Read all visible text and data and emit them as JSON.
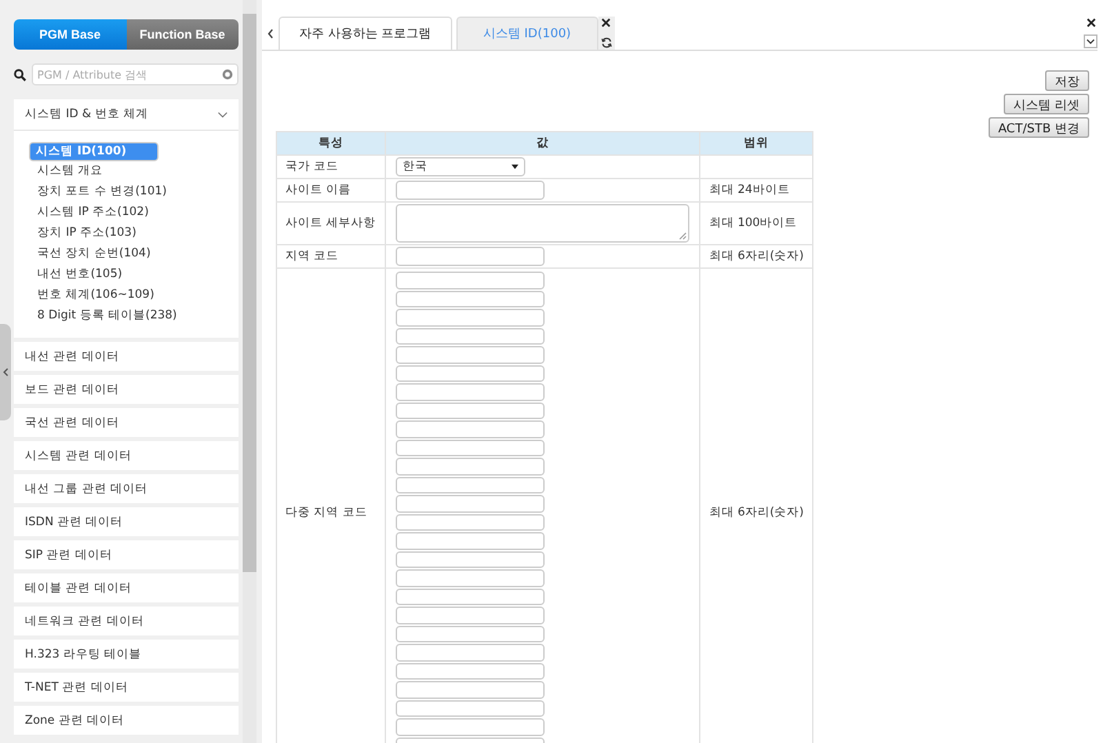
{
  "sidebar": {
    "mode_toggle": [
      {
        "label": "PGM Base",
        "selected": true
      },
      {
        "label": "Function Base",
        "selected": false
      }
    ],
    "search": {
      "placeholder": "PGM / Attribute 검색"
    },
    "groups": [
      {
        "title": "시스템 ID & 번호 체계",
        "expanded": true,
        "items": [
          {
            "label": "시스템 ID(100)",
            "selected": true
          },
          {
            "label": "시스템 개요",
            "selected": false
          },
          {
            "label": "장치 포트 수 변경(101)",
            "selected": false
          },
          {
            "label": "시스템 IP 주소(102)",
            "selected": false
          },
          {
            "label": "장치 IP 주소(103)",
            "selected": false
          },
          {
            "label": "국선 장치 순번(104)",
            "selected": false
          },
          {
            "label": "내선 번호(105)",
            "selected": false
          },
          {
            "label": "번호 체계(106~109)",
            "selected": false
          },
          {
            "label": "8 Digit 등록 테이블(238)",
            "selected": false
          }
        ]
      },
      {
        "title": "내선 관련 데이터",
        "expanded": false
      },
      {
        "title": "보드 관련 데이터",
        "expanded": false
      },
      {
        "title": "국선 관련 데이터",
        "expanded": false
      },
      {
        "title": "시스템 관련 데이터",
        "expanded": false
      },
      {
        "title": "내선 그룹 관련 데이터",
        "expanded": false
      },
      {
        "title": "ISDN 관련 데이터",
        "expanded": false
      },
      {
        "title": "SIP 관련 데이터",
        "expanded": false
      },
      {
        "title": "테이블 관련 데이터",
        "expanded": false
      },
      {
        "title": "네트워크 관련 데이터",
        "expanded": false
      },
      {
        "title": "H.323 라우팅 테이블",
        "expanded": false
      },
      {
        "title": "T-NET 관련 데이터",
        "expanded": false
      },
      {
        "title": "Zone 관련 데이터",
        "expanded": false
      }
    ]
  },
  "tabs": [
    {
      "label": "자주 사용하는 프로그램",
      "selected": false
    },
    {
      "label": "시스템 ID(100)",
      "selected": true
    }
  ],
  "buttons": [
    "저장",
    "시스템 리셋",
    "ACT/STB 변경"
  ],
  "table": {
    "columns": [
      "특성",
      "값",
      "범위"
    ],
    "rows": [
      {
        "name": "국가 코드",
        "kind": "select",
        "value": "한국",
        "range": ""
      },
      {
        "name": "사이트 이름",
        "kind": "text",
        "range": "최대 24바이트"
      },
      {
        "name": "사이트 세부사항",
        "kind": "textarea",
        "range": "최대 100바이트"
      },
      {
        "name": "지역 코드",
        "kind": "text",
        "range": "최대 6자리(숫자)"
      },
      {
        "name": "다중 지역 코드",
        "kind": "multi",
        "range": "최대 6자리(숫자)",
        "inputs": [
          {
            "kind": "text"
          },
          {
            "kind": "text"
          },
          {
            "kind": "text"
          },
          {
            "kind": "text"
          },
          {
            "kind": "text"
          },
          {
            "kind": "text"
          },
          {
            "kind": "text"
          },
          {
            "kind": "text"
          },
          {
            "kind": "text"
          },
          {
            "kind": "text"
          },
          {
            "kind": "text"
          },
          {
            "kind": "text"
          },
          {
            "kind": "text"
          },
          {
            "kind": "text"
          },
          {
            "kind": "text"
          },
          {
            "kind": "text"
          },
          {
            "kind": "text"
          },
          {
            "kind": "text"
          },
          {
            "kind": "text"
          },
          {
            "kind": "text"
          },
          {
            "kind": "text"
          },
          {
            "kind": "text"
          },
          {
            "kind": "text"
          },
          {
            "kind": "text"
          },
          {
            "kind": "text"
          },
          {
            "kind": "text"
          }
        ]
      }
    ]
  }
}
